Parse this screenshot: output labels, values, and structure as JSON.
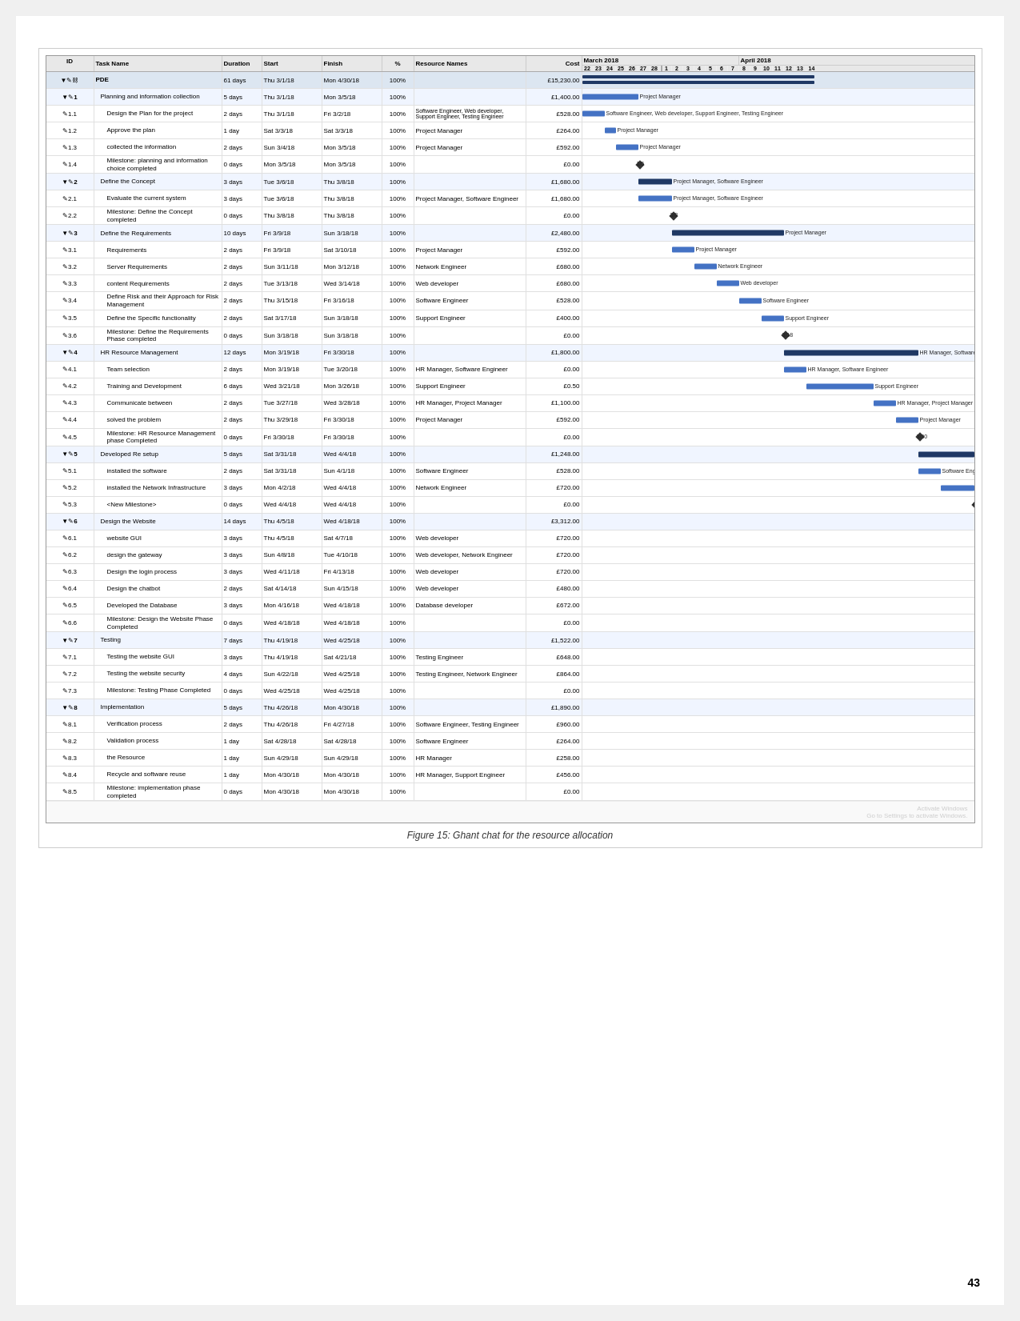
{
  "figure": {
    "caption": "Figure 15: Ghant chat for the resource allocation",
    "page_number": "43"
  },
  "gantt": {
    "headers": {
      "id_col": "ID",
      "name_col": "Task Name",
      "dur_col": "Duration",
      "start_col": "Start",
      "end_col": "Finish",
      "pct_col": "%",
      "res_col": "Resource Names",
      "cost_col": "Cost"
    },
    "months": [
      {
        "label": "March 2018",
        "days": [
          "22",
          "23",
          "24",
          "25",
          "26",
          "27",
          "28",
          "1",
          "2",
          "3",
          "4",
          "5",
          "6",
          "7"
        ]
      },
      {
        "label": "April 2018",
        "days": [
          "8",
          "9",
          "10",
          "11",
          "12",
          "13",
          "14"
        ]
      }
    ],
    "rows": [
      {
        "id": "0",
        "num": "",
        "name": "PDE",
        "dur": "61 days",
        "start": "Thu 3/1/18",
        "end": "Mon 4/30/18",
        "pct": "100%",
        "res": "",
        "cost": "£15,230.00",
        "level": 0,
        "type": "summary"
      },
      {
        "id": "1",
        "num": "1",
        "name": "Planning and information collection",
        "dur": "5 days",
        "start": "Thu 3/1/18",
        "end": "Mon 3/5/18",
        "pct": "100%",
        "res": "",
        "cost": "£1,400.00",
        "level": 1,
        "type": "phase"
      },
      {
        "id": "1.1",
        "num": "",
        "name": "Design the Plan for the project",
        "dur": "2 days",
        "start": "Thu 3/1/18",
        "end": "Fri 3/2/18",
        "pct": "100%",
        "res": "Software Engineer, Web developer, Support Engineer, Testing Engineer",
        "cost": "£528.00",
        "level": 2,
        "type": "task"
      },
      {
        "id": "1.2",
        "num": "",
        "name": "Approve the plan",
        "dur": "1 day",
        "start": "Sat 3/3/18",
        "end": "Sat 3/3/18",
        "pct": "100%",
        "res": "Project Manager",
        "cost": "£264.00",
        "level": 2,
        "type": "task"
      },
      {
        "id": "1.3",
        "num": "",
        "name": "collected the information",
        "dur": "2 days",
        "start": "Sun 3/4/18",
        "end": "Mon 3/5/18",
        "pct": "100%",
        "res": "Project Manager",
        "cost": "£592.00",
        "level": 2,
        "type": "task"
      },
      {
        "id": "1.4",
        "num": "",
        "name": "Milestone: planning and information choice completed",
        "dur": "0 days",
        "start": "Mon 3/5/18",
        "end": "Mon 3/5/18",
        "pct": "100%",
        "res": "",
        "cost": "£0.00",
        "level": 2,
        "type": "milestone"
      },
      {
        "id": "2",
        "num": "2",
        "name": "Define the Concept",
        "dur": "3 days",
        "start": "Tue 3/6/18",
        "end": "Thu 3/8/18",
        "pct": "100%",
        "res": "",
        "cost": "£1,680.00",
        "level": 1,
        "type": "phase"
      },
      {
        "id": "2.1",
        "num": "",
        "name": "Evaluate the current system",
        "dur": "3 days",
        "start": "Tue 3/6/18",
        "end": "Thu 3/8/18",
        "pct": "100%",
        "res": "Project Manager, Software Engineer",
        "cost": "£1,680.00",
        "level": 2,
        "type": "task"
      },
      {
        "id": "2.2",
        "num": "",
        "name": "Milestone: Define the Concept completed",
        "dur": "0 days",
        "start": "Thu 3/8/18",
        "end": "Thu 3/8/18",
        "pct": "100%",
        "res": "",
        "cost": "£0.00",
        "level": 2,
        "type": "milestone"
      },
      {
        "id": "3",
        "num": "3",
        "name": "Define the Requirements",
        "dur": "10 days",
        "start": "Fri 3/9/18",
        "end": "Sun 3/18/18",
        "pct": "100%",
        "res": "",
        "cost": "£2,480.00",
        "level": 1,
        "type": "phase"
      },
      {
        "id": "3.1",
        "num": "",
        "name": "Requirements",
        "dur": "2 days",
        "start": "Fri 3/9/18",
        "end": "Sat 3/10/18",
        "pct": "100%",
        "res": "Project Manager",
        "cost": "£592.00",
        "level": 2,
        "type": "task"
      },
      {
        "id": "3.2",
        "num": "",
        "name": "Server Requirements",
        "dur": "2 days",
        "start": "Sun 3/11/18",
        "end": "Mon 3/12/18",
        "pct": "100%",
        "res": "Network Engineer",
        "cost": "£680.00",
        "level": 2,
        "type": "task"
      },
      {
        "id": "3.3",
        "num": "",
        "name": "content Requirements",
        "dur": "2 days",
        "start": "Tue 3/13/18",
        "end": "Wed 3/14/18",
        "pct": "100%",
        "res": "Web developer",
        "cost": "£680.00",
        "level": 2,
        "type": "task"
      },
      {
        "id": "3.4",
        "num": "",
        "name": "Define Risk and their Approach for Risk Management",
        "dur": "2 days",
        "start": "Thu 3/15/18",
        "end": "Fri 3/16/18",
        "pct": "100%",
        "res": "Software Engineer",
        "cost": "£528.00",
        "level": 2,
        "type": "task"
      },
      {
        "id": "3.5",
        "num": "",
        "name": "Define the Specific functionality",
        "dur": "2 days",
        "start": "Sat 3/17/18",
        "end": "Sun 3/18/18",
        "pct": "100%",
        "res": "Support Engineer",
        "cost": "£400.00",
        "level": 2,
        "type": "task"
      },
      {
        "id": "3.6",
        "num": "",
        "name": "Milestone: Define the Requirements Phase completed",
        "dur": "0 days",
        "start": "Sun 3/18/18",
        "end": "Sun 3/18/18",
        "pct": "100%",
        "res": "",
        "cost": "£0.00",
        "level": 2,
        "type": "milestone"
      },
      {
        "id": "4",
        "num": "4",
        "name": "HR Resource Management",
        "dur": "12 days",
        "start": "Mon 3/19/18",
        "end": "Fri 3/30/18",
        "pct": "100%",
        "res": "",
        "cost": "£1,800.00",
        "level": 1,
        "type": "phase"
      },
      {
        "id": "4.1",
        "num": "",
        "name": "Team selection",
        "dur": "2 days",
        "start": "Mon 3/19/18",
        "end": "Tue 3/20/18",
        "pct": "100%",
        "res": "HR Manager, Software Engineer",
        "cost": "£0.00",
        "level": 2,
        "type": "task"
      },
      {
        "id": "4.2",
        "num": "",
        "name": "Training and Development",
        "dur": "6 days",
        "start": "Wed 3/21/18",
        "end": "Mon 3/26/18",
        "pct": "100%",
        "res": "Support Engineer",
        "cost": "£0.50",
        "level": 2,
        "type": "task"
      },
      {
        "id": "4.3",
        "num": "",
        "name": "Communicate between",
        "dur": "2 days",
        "start": "Tue 3/27/18",
        "end": "Wed 3/28/18",
        "pct": "100%",
        "res": "HR Manager, Project Manager",
        "cost": "£1,100.00",
        "level": 2,
        "type": "task"
      },
      {
        "id": "4.4",
        "num": "",
        "name": "solved the problem",
        "dur": "2 days",
        "start": "Thu 3/29/18",
        "end": "Fri 3/30/18",
        "pct": "100%",
        "res": "Project Manager",
        "cost": "£592.00",
        "level": 2,
        "type": "task"
      },
      {
        "id": "4.5",
        "num": "",
        "name": "Milestone: HR Resource Management phase Completed",
        "dur": "0 days",
        "start": "Fri 3/30/18",
        "end": "Fri 3/30/18",
        "pct": "100%",
        "res": "",
        "cost": "£0.00",
        "level": 2,
        "type": "milestone"
      },
      {
        "id": "5",
        "num": "5",
        "name": "Developed Re setup",
        "dur": "5 days",
        "start": "Sat 3/31/18",
        "end": "Wed 4/4/18",
        "pct": "100%",
        "res": "",
        "cost": "£1,248.00",
        "level": 1,
        "type": "phase"
      },
      {
        "id": "5.1",
        "num": "",
        "name": "installed the software",
        "dur": "2 days",
        "start": "Sat 3/31/18",
        "end": "Sun 4/1/18",
        "pct": "100%",
        "res": "Software Engineer",
        "cost": "£528.00",
        "level": 2,
        "type": "task"
      },
      {
        "id": "5.2",
        "num": "",
        "name": "installed the Network Infrastructure",
        "dur": "3 days",
        "start": "Mon 4/2/18",
        "end": "Wed 4/4/18",
        "pct": "100%",
        "res": "Network Engineer",
        "cost": "£720.00",
        "level": 2,
        "type": "task"
      },
      {
        "id": "5.3",
        "num": "",
        "name": "<New Milestone>",
        "dur": "0 days",
        "start": "Wed 4/4/18",
        "end": "Wed 4/4/18",
        "pct": "100%",
        "res": "",
        "cost": "£0.00",
        "level": 2,
        "type": "milestone"
      },
      {
        "id": "6",
        "num": "6",
        "name": "Design the Website",
        "dur": "14 days",
        "start": "Thu 4/5/18",
        "end": "Wed 4/18/18",
        "pct": "100%",
        "res": "",
        "cost": "£3,312.00",
        "level": 1,
        "type": "phase"
      },
      {
        "id": "6.1",
        "num": "",
        "name": "website GUI",
        "dur": "3 days",
        "start": "Thu 4/5/18",
        "end": "Sat 4/7/18",
        "pct": "100%",
        "res": "Web developer",
        "cost": "£720.00",
        "level": 2,
        "type": "task"
      },
      {
        "id": "6.2",
        "num": "",
        "name": "design the gateway",
        "dur": "3 days",
        "start": "Sun 4/8/18",
        "end": "Tue 4/10/18",
        "pct": "100%",
        "res": "Web developer, Network Engineer",
        "cost": "£720.00",
        "level": 2,
        "type": "task"
      },
      {
        "id": "6.3",
        "num": "",
        "name": "Design the login process",
        "dur": "3 days",
        "start": "Wed 4/11/18",
        "end": "Fri 4/13/18",
        "pct": "100%",
        "res": "Web developer",
        "cost": "£720.00",
        "level": 2,
        "type": "task"
      },
      {
        "id": "6.4",
        "num": "",
        "name": "Design the chatbot",
        "dur": "2 days",
        "start": "Sat 4/14/18",
        "end": "Sun 4/15/18",
        "pct": "100%",
        "res": "Web developer",
        "cost": "£480.00",
        "level": 2,
        "type": "task"
      },
      {
        "id": "6.5",
        "num": "",
        "name": "Developed the Database",
        "dur": "3 days",
        "start": "Mon 4/16/18",
        "end": "Wed 4/18/18",
        "pct": "100%",
        "res": "Database developer",
        "cost": "£672.00",
        "level": 2,
        "type": "task"
      },
      {
        "id": "6.6",
        "num": "",
        "name": "Milestone: Design the Website Phase Completed",
        "dur": "0 days",
        "start": "Wed 4/18/18",
        "end": "Wed 4/18/18",
        "pct": "100%",
        "res": "",
        "cost": "£0.00",
        "level": 2,
        "type": "milestone"
      },
      {
        "id": "7",
        "num": "7",
        "name": "Testing",
        "dur": "7 days",
        "start": "Thu 4/19/18",
        "end": "Wed 4/25/18",
        "pct": "100%",
        "res": "",
        "cost": "£1,522.00",
        "level": 1,
        "type": "phase"
      },
      {
        "id": "7.1",
        "num": "",
        "name": "Testing the website GUI",
        "dur": "3 days",
        "start": "Thu 4/19/18",
        "end": "Sat 4/21/18",
        "pct": "100%",
        "res": "Testing Engineer",
        "cost": "£648.00",
        "level": 2,
        "type": "task"
      },
      {
        "id": "7.2",
        "num": "",
        "name": "Testing the website security",
        "dur": "4 days",
        "start": "Sun 4/22/18",
        "end": "Wed 4/25/18",
        "pct": "100%",
        "res": "Testing Engineer, Network Engineer",
        "cost": "£864.00",
        "level": 2,
        "type": "task"
      },
      {
        "id": "7.3",
        "num": "",
        "name": "Milestone: Testing Phase Completed",
        "dur": "0 days",
        "start": "Wed 4/25/18",
        "end": "Wed 4/25/18",
        "pct": "100%",
        "res": "",
        "cost": "£0.00",
        "level": 2,
        "type": "milestone"
      },
      {
        "id": "8",
        "num": "8",
        "name": "Implementation",
        "dur": "5 days",
        "start": "Thu 4/26/18",
        "end": "Mon 4/30/18",
        "pct": "100%",
        "res": "",
        "cost": "£1,890.00",
        "level": 1,
        "type": "phase"
      },
      {
        "id": "8.1",
        "num": "",
        "name": "Verification process",
        "dur": "2 days",
        "start": "Thu 4/26/18",
        "end": "Fri 4/27/18",
        "pct": "100%",
        "res": "Software Engineer, Testing Engineer",
        "cost": "£960.00",
        "level": 2,
        "type": "task"
      },
      {
        "id": "8.2",
        "num": "",
        "name": "Validation process",
        "dur": "1 day",
        "start": "Sat 4/28/18",
        "end": "Sat 4/28/18",
        "pct": "100%",
        "res": "Software Engineer",
        "cost": "£264.00",
        "level": 2,
        "type": "task"
      },
      {
        "id": "8.3",
        "num": "",
        "name": "the Resource",
        "dur": "1 day",
        "start": "Sun 4/29/18",
        "end": "Sun 4/29/18",
        "pct": "100%",
        "res": "HR Manager",
        "cost": "£258.00",
        "level": 2,
        "type": "task"
      },
      {
        "id": "8.4",
        "num": "",
        "name": "Recycle and software reuse",
        "dur": "1 day",
        "start": "Mon 4/30/18",
        "end": "Mon 4/30/18",
        "pct": "100%",
        "res": "HR Manager, Support Engineer",
        "cost": "£456.00",
        "level": 2,
        "type": "task"
      },
      {
        "id": "8.5",
        "num": "",
        "name": "Milestone: implementation phase completed",
        "dur": "0 days",
        "start": "Mon 4/30/18",
        "end": "Mon 4/30/18",
        "pct": "100%",
        "res": "",
        "cost": "£0.00",
        "level": 2,
        "type": "milestone"
      }
    ]
  }
}
